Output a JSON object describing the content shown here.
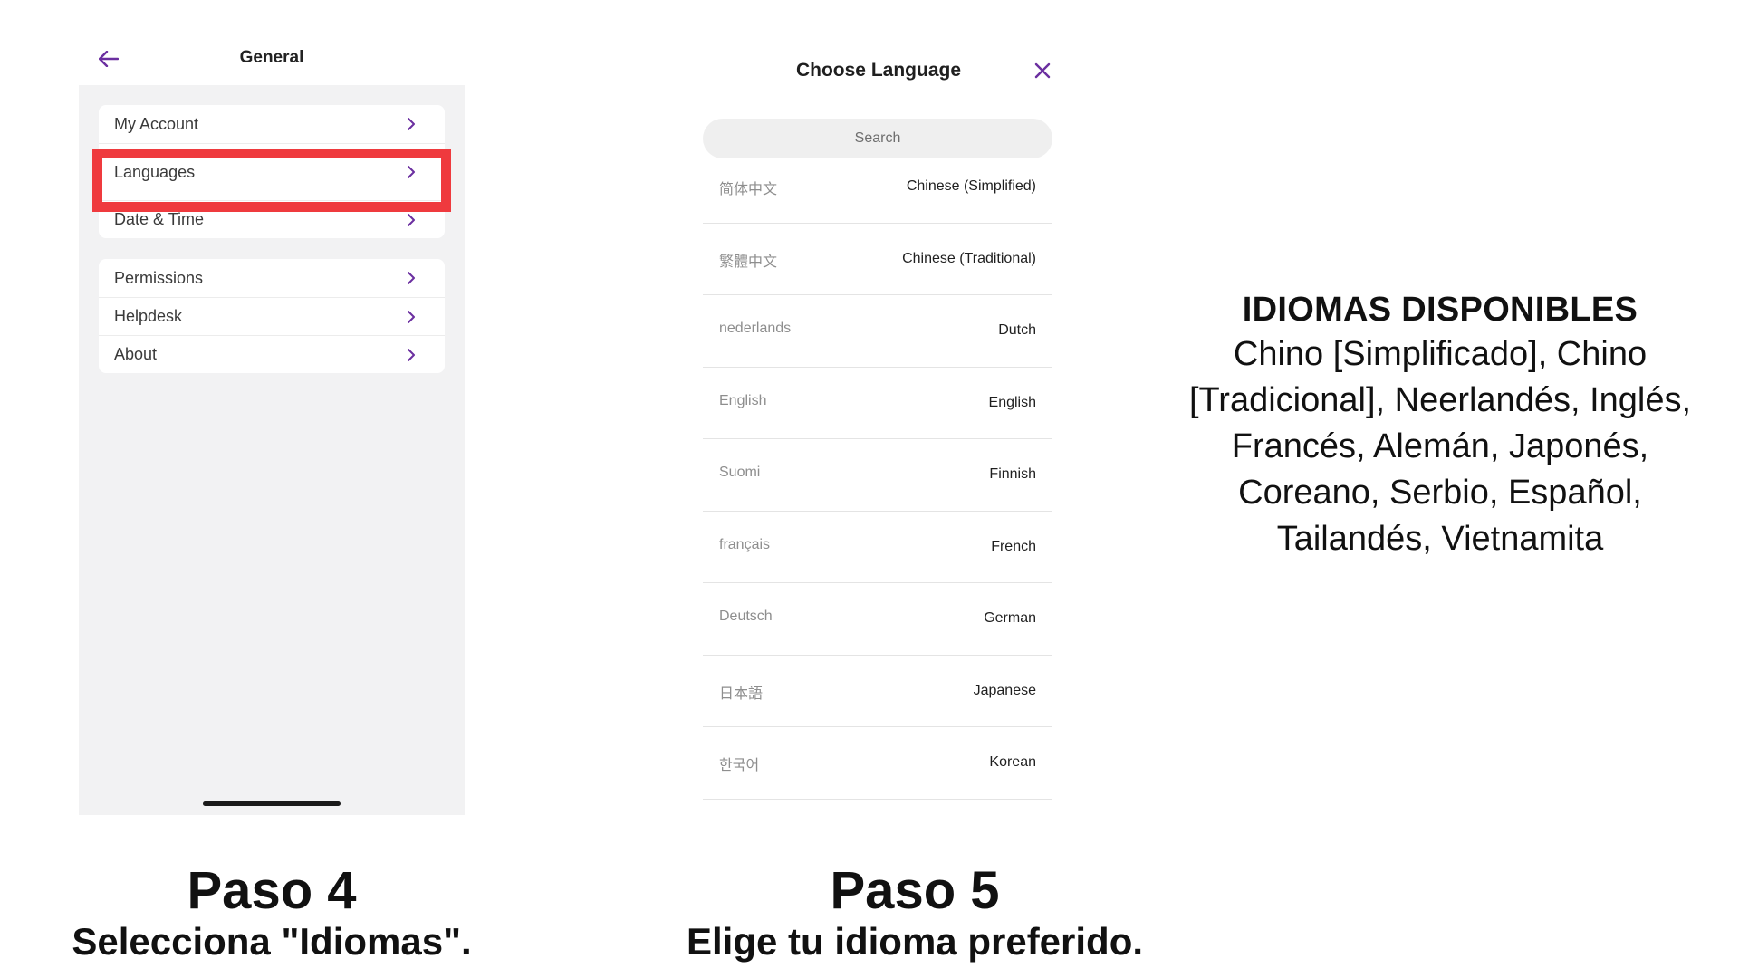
{
  "colors": {
    "accent": "#6b2fa0",
    "highlight": "#ef3a3e",
    "panel_bg": "#f2f2f3"
  },
  "general_screen": {
    "title": "General",
    "back_icon": "arrow-left-icon",
    "group1": [
      "My Account",
      "Languages",
      "Date & Time"
    ],
    "group2": [
      "Permissions",
      "Helpdesk",
      "About"
    ],
    "highlighted_item": "Languages"
  },
  "language_screen": {
    "title": "Choose Language",
    "close_icon": "close-icon",
    "search_placeholder": "Search",
    "languages": [
      {
        "native": "简体中文",
        "english": "Chinese (Simplified)"
      },
      {
        "native": "繁體中文",
        "english": "Chinese (Traditional)"
      },
      {
        "native": "nederlands",
        "english": "Dutch"
      },
      {
        "native": "English",
        "english": "English"
      },
      {
        "native": "Suomi",
        "english": "Finnish"
      },
      {
        "native": "français",
        "english": "French"
      },
      {
        "native": "Deutsch",
        "english": "German"
      },
      {
        "native": "日本語",
        "english": "Japanese"
      },
      {
        "native": "한국어",
        "english": "Korean"
      }
    ]
  },
  "info": {
    "heading": "IDIOMAS DISPONIBLES",
    "body": "Chino [Simplificado], Chino [Tradicional], Neerlandés, Inglés, Francés, Alemán, Japonés, Coreano, Serbio, Español, Tailandés, Vietnamita"
  },
  "steps": {
    "step4_title": "Paso 4",
    "step4_desc": "Selecciona \"Idiomas\".",
    "step5_title": "Paso 5",
    "step5_desc": "Elige tu idioma preferido."
  }
}
